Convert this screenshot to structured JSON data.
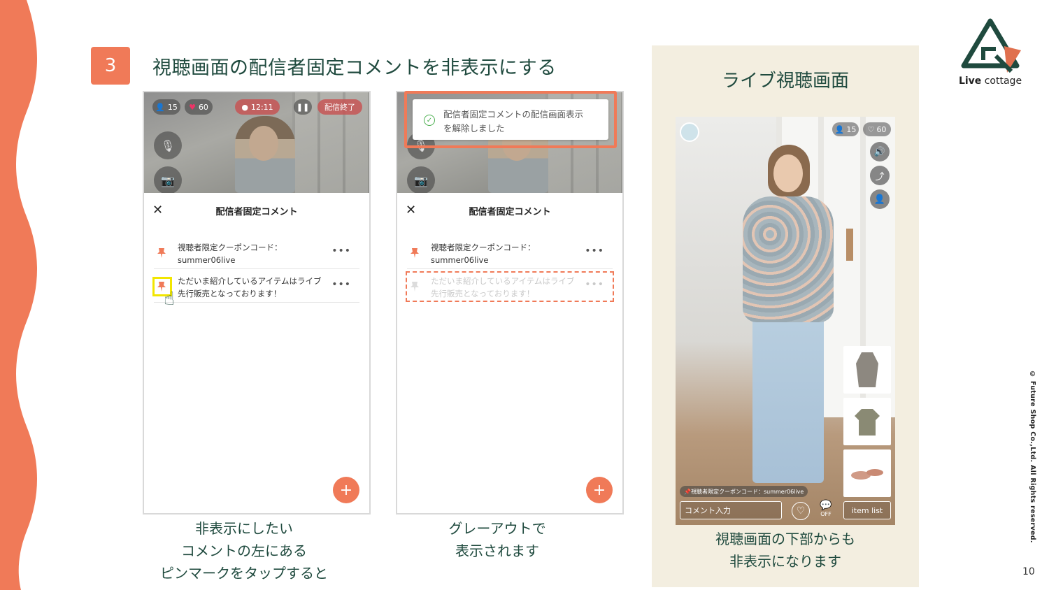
{
  "step_number": "3",
  "title": "視聴画面の配信者固定コメントを非表示にする",
  "phone_left": {
    "viewers": "15",
    "likes": "60",
    "timer": "12:11",
    "end_button": "配信終了",
    "sheet_title": "配信者固定コメント",
    "comments": [
      {
        "line1": "視聴者限定クーポンコード：",
        "line2": "summer06live"
      },
      {
        "line1": "ただいま紹介しているアイテムはライブ",
        "line2": "先行販売となっております！"
      }
    ]
  },
  "phone_right": {
    "toast_line1": "配信者固定コメントの配信画面表示",
    "toast_line2": "を解除しました",
    "sheet_title": "配信者固定コメント",
    "comments": [
      {
        "line1": "視聴者限定クーポンコード：",
        "line2": "summer06live"
      },
      {
        "line1": "ただいま紹介しているアイテムはライブ",
        "line2": "先行販売となっております！"
      }
    ]
  },
  "caption_left": [
    "非表示にしたい",
    "コメントの左にある",
    "ピンマークをタップすると"
  ],
  "caption_middle": [
    "グレーアウトで",
    "表示されます"
  ],
  "panel": {
    "title": "ライブ視聴画面",
    "viewers": "15",
    "likes": "60",
    "pinned_comment": "視聴者限定クーポンコード：summer06live",
    "comment_input": "コメント入力",
    "bubble_off": "OFF",
    "item_list": "item list",
    "caption": [
      "視聴画面の下部からも",
      "非表示になります"
    ]
  },
  "logo": {
    "bold": "Live",
    "rest": " cottage"
  },
  "copyright": "© Future Shop Co.,Ltd. All Rights reserved.",
  "page_number": "10",
  "colors": {
    "accent": "#f07a58",
    "text": "#1f4a3e",
    "highlight": "#f2e600",
    "panel_bg": "#f3eee0"
  }
}
